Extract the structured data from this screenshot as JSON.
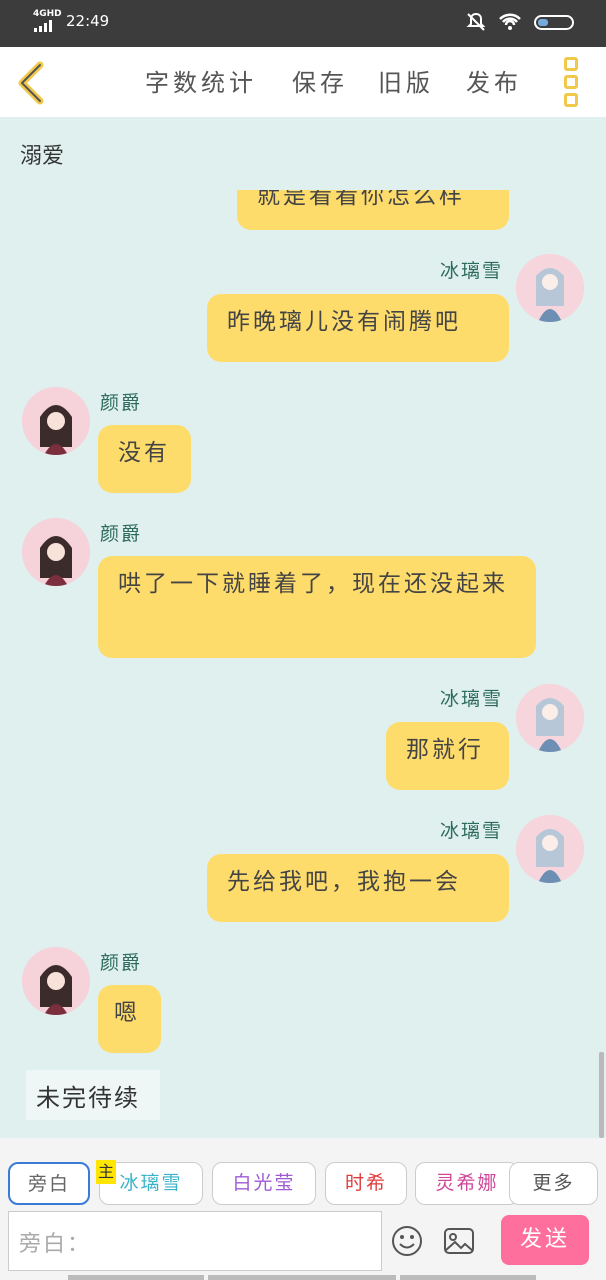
{
  "status_bar": {
    "network": "4GHD",
    "time": "22:49"
  },
  "toolbar": {
    "items": [
      "字数统计",
      "保存",
      "旧版",
      "发布"
    ]
  },
  "page_title": "溺爱",
  "messages": [
    {
      "side": "right",
      "speaker": "",
      "text": "就是看看你怎么样"
    },
    {
      "side": "right",
      "speaker": "冰璃雪",
      "text": "昨晚璃儿没有闹腾吧"
    },
    {
      "side": "left",
      "speaker": "颜爵",
      "text": "没有"
    },
    {
      "side": "left",
      "speaker": "颜爵",
      "text": "哄了一下就睡着了，现在还没起来"
    },
    {
      "side": "right",
      "speaker": "冰璃雪",
      "text": "那就行"
    },
    {
      "side": "right",
      "speaker": "冰璃雪",
      "text": "先给我吧，我抱一会"
    },
    {
      "side": "left",
      "speaker": "颜爵",
      "text": "嗯"
    }
  ],
  "to_be_continued": "未完待续",
  "roles": {
    "badge": "主",
    "chips": [
      {
        "label": "旁白",
        "color": "#666666"
      },
      {
        "label": "冰璃雪",
        "color": "#3bb3c9"
      },
      {
        "label": "白光莹",
        "color": "#a05ad6"
      },
      {
        "label": "时希",
        "color": "#e03c3c"
      },
      {
        "label": "灵希娜",
        "color": "#d0479a"
      },
      {
        "label": "更多",
        "color": "#555555"
      }
    ]
  },
  "input": {
    "placeholder": "旁白："
  },
  "send_label": "发送",
  "icons": [
    "back-chevron-icon",
    "more-menu-icon",
    "emoji-icon",
    "image-icon"
  ]
}
